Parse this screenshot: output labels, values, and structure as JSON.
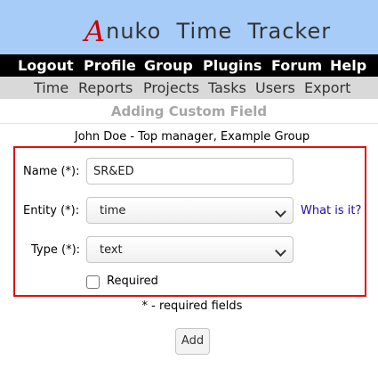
{
  "header": {
    "logo_initial": "A",
    "logo_rest": "nuko  Time  Tracker"
  },
  "top_nav": [
    "Logout",
    "Profile",
    "Group",
    "Plugins",
    "Forum",
    "Help"
  ],
  "sub_nav": [
    "Time",
    "Reports",
    "Projects",
    "Tasks",
    "Users",
    "Export"
  ],
  "page": {
    "title": "Adding Custom Field",
    "user_line": "John Doe - Top manager, Example Group"
  },
  "form": {
    "name_label": "Name (*):",
    "name_value": "SR&ED",
    "entity_label": "Entity (*):",
    "entity_value": "time",
    "what_is_it": "What is it?",
    "type_label": "Type (*):",
    "type_value": "text",
    "required_label": "Required",
    "required_checked": false,
    "required_note": "* - required fields",
    "add_label": "Add"
  },
  "colors": {
    "header_bg": "#a6ccf7",
    "nav_bg": "#000000",
    "subnav_bg": "#d9d9d9",
    "form_border": "#e01010",
    "logo_accent": "#cc0000",
    "link": "#1a0dab"
  }
}
